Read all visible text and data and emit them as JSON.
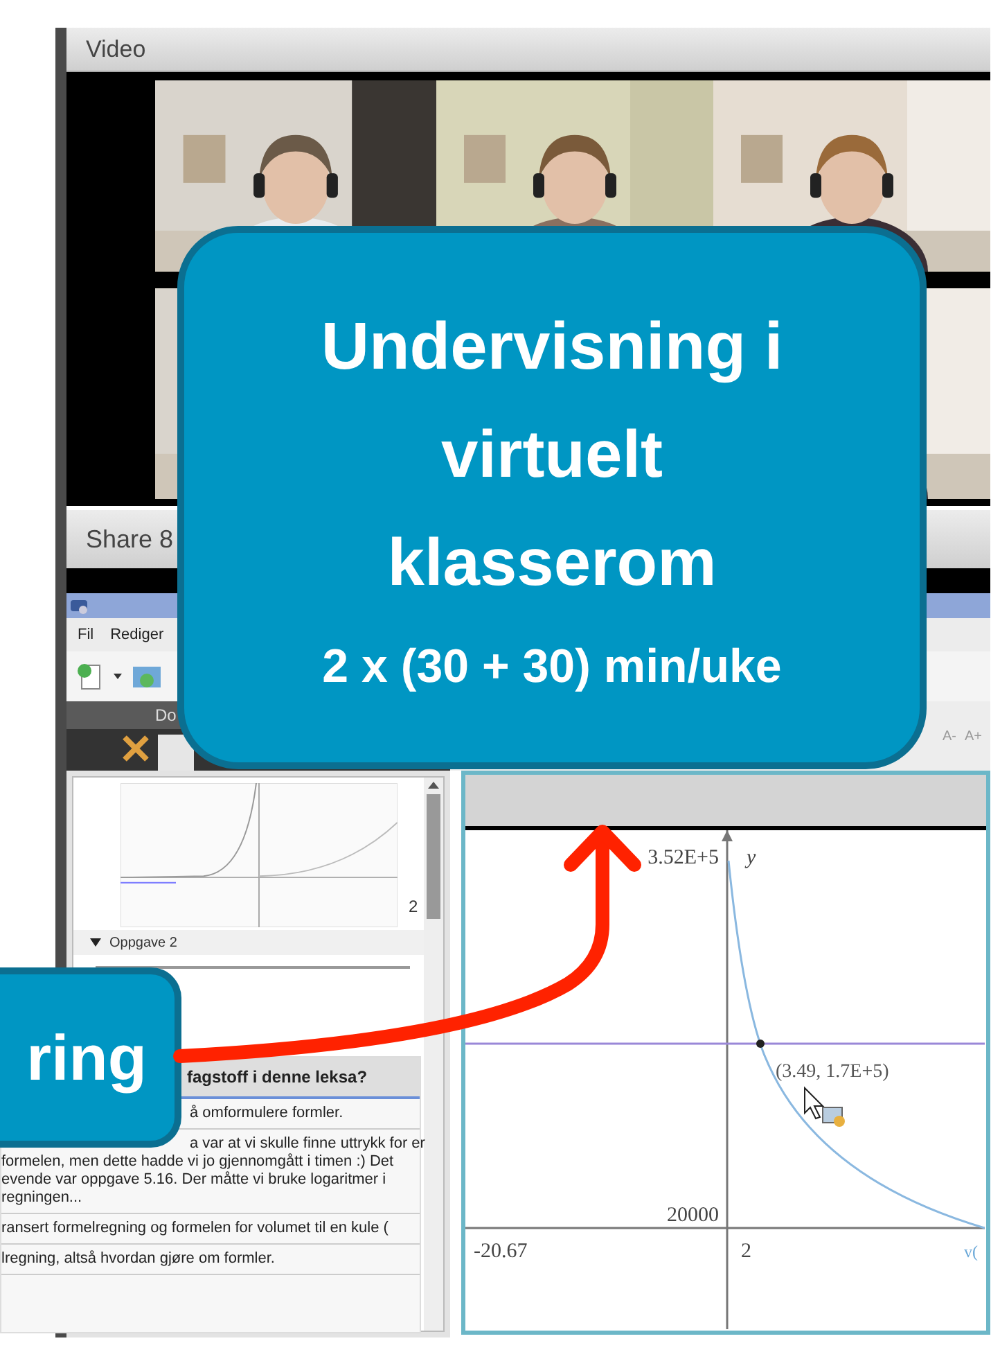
{
  "video_panel": {
    "title": "Video"
  },
  "share_panel": {
    "title": "Share 8"
  },
  "app": {
    "menu": [
      "Fil",
      "Rediger"
    ],
    "panel_tab": "Do",
    "font_buttons": [
      "A-",
      "A+"
    ]
  },
  "document": {
    "page_number": "2",
    "section": {
      "label": "Oppgave 2",
      "expanded": true
    }
  },
  "survey_table": {
    "header": "fagstoff i denne leksa?",
    "rows": [
      {
        "lines": [
          "å omformulere formler."
        ]
      },
      {
        "lines": [
          "a var at vi skulle finne uttrykk for er",
          "formelen, men dette hadde vi jo gjennomgått i timen :) Det",
          "evende var oppgave 5.16. Der måtte vi bruke logaritmer i",
          "regningen..."
        ]
      },
      {
        "lines": [
          "ransert formelregning og formelen for volumet til en kule ("
        ]
      },
      {
        "lines": [
          "lregning, altså hvordan gjøre om formler."
        ]
      }
    ]
  },
  "graph": {
    "y_max": "3.52E+5",
    "y_axis": "y",
    "point": "(3.49, 1.7E+5)",
    "y_tick": "20000",
    "x_min": "-20.67",
    "x_tick": "2",
    "function": "v("
  },
  "callouts": [
    {
      "kind": "main",
      "title": "Undervisning i virtuelt klasserom",
      "subtitle": "2 x (30 + 30) min/uke"
    },
    {
      "kind": "side",
      "title": "ring"
    }
  ]
}
